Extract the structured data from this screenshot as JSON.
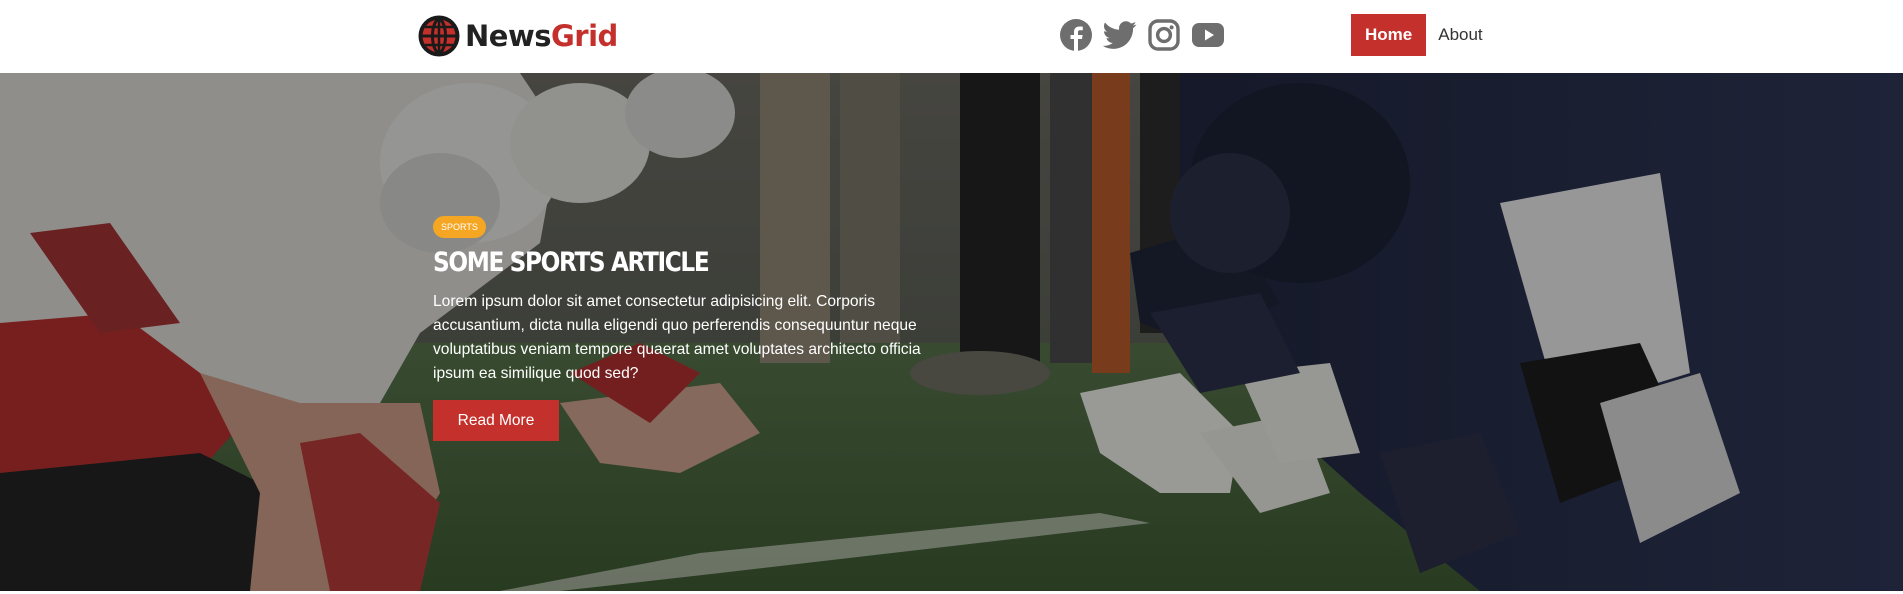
{
  "brand": {
    "name_part1": "News",
    "name_part2": "Grid"
  },
  "social": [
    {
      "name": "facebook-icon"
    },
    {
      "name": "twitter-icon"
    },
    {
      "name": "instagram-icon"
    },
    {
      "name": "youtube-icon"
    }
  ],
  "nav": {
    "home_label": "Home",
    "about_label": "About"
  },
  "hero": {
    "category": "SPORTS",
    "title": "SOME SPORTS ARTICLE",
    "description": "Lorem ipsum dolor sit amet consectetur adipisicing elit. Corporis accusantium, dicta nulla eligendi quo perferendis consequuntur neque voluptatibus veniam tempore quaerat amet voluptates architecto officia ipsum ea similique quod sed?",
    "button_label": "Read More",
    "background": "football-linemen-lineup-photo"
  },
  "colors": {
    "accent": "#c4302b",
    "badge": "#f5a623",
    "icon_gray": "#6e6e6e"
  }
}
